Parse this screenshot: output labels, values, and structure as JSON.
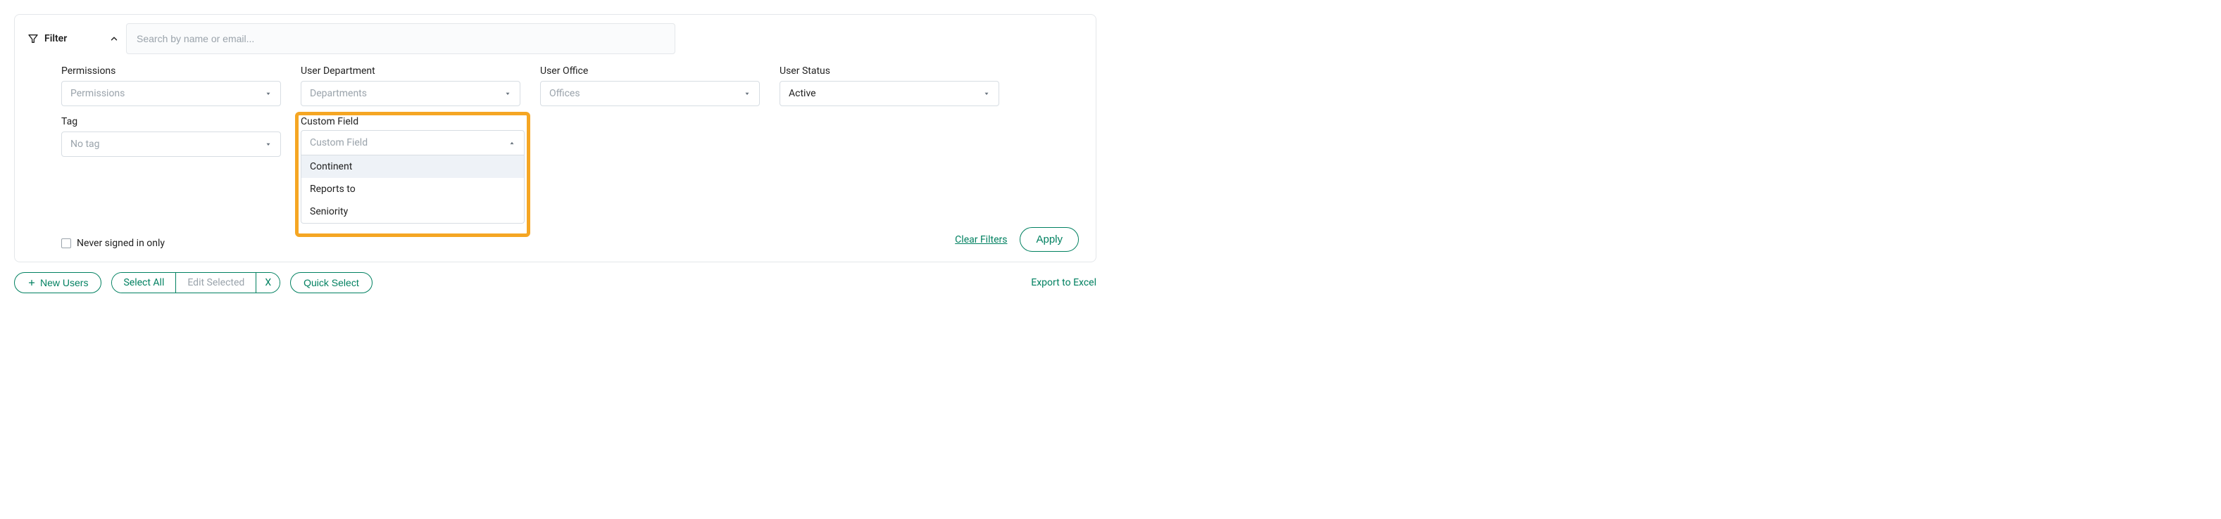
{
  "filter_toggle": {
    "label": "Filter"
  },
  "search": {
    "placeholder": "Search by name or email..."
  },
  "filters": {
    "permissions": {
      "label": "Permissions",
      "placeholder": "Permissions"
    },
    "department": {
      "label": "User Department",
      "placeholder": "Departments"
    },
    "office": {
      "label": "User Office",
      "placeholder": "Offices"
    },
    "status": {
      "label": "User Status",
      "value": "Active"
    },
    "tag": {
      "label": "Tag",
      "placeholder": "No tag"
    },
    "custom_field": {
      "label": "Custom Field",
      "placeholder": "Custom Field",
      "options": [
        "Continent",
        "Reports to",
        "Seniority"
      ]
    }
  },
  "never_signed_in": {
    "label": "Never signed in only"
  },
  "actions": {
    "clear": "Clear Filters",
    "apply": "Apply"
  },
  "bottom": {
    "new_users": "New Users",
    "select_all": "Select All",
    "edit_selected": "Edit Selected",
    "x": "X",
    "quick_select": "Quick Select",
    "export": "Export to Excel"
  }
}
